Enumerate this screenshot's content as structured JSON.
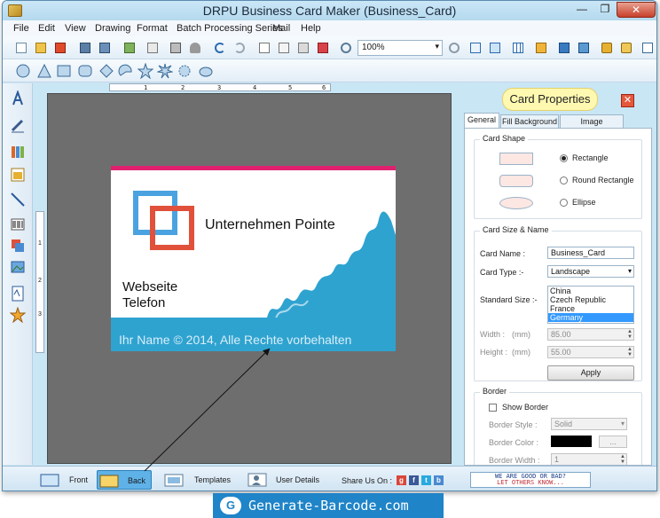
{
  "window": {
    "title": "DRPU Business Card Maker (Business_Card)",
    "minimize": "—",
    "maximize": "❐",
    "close": "✕"
  },
  "menu": [
    "File",
    "Edit",
    "View",
    "Drawing",
    "Format",
    "Batch Processing Series",
    "Mail",
    "Help"
  ],
  "toolbar": {
    "zoom_value": "100%",
    "zoom_arrow": "▾"
  },
  "ruler": {
    "h_marks": [
      "1",
      "2",
      "3",
      "4",
      "5",
      "6"
    ],
    "v_marks": [
      "1",
      "2",
      "3"
    ]
  },
  "card": {
    "company": "Unternehmen Pointe",
    "website": "Webseite",
    "phone": "Telefon",
    "footer": "Ihr Name © 2014, Alle Rechte vorbehalten"
  },
  "properties": {
    "title": "Card Properties",
    "close": "✕",
    "tabs": [
      "General",
      "Fill Background",
      "Image Processing"
    ],
    "card_shape": {
      "title": "Card Shape",
      "options": [
        "Rectangle",
        "Round Rectangle",
        "Ellipse"
      ],
      "selected": "Rectangle"
    },
    "size": {
      "title": "Card Size & Name",
      "name_label": "Card Name :",
      "name_value": "Business_Card",
      "type_label": "Card Type :-",
      "type_value": "Landscape",
      "standard_label": "Standard Size :-",
      "standard_options": [
        "China",
        "Czech Republic",
        "France",
        "Germany"
      ],
      "standard_selected": "Germany",
      "width_label": "Width :",
      "height_label": "Height :",
      "unit": "(mm)",
      "width_value": "85.00",
      "height_value": "55.00",
      "apply": "Apply"
    },
    "border": {
      "title": "Border",
      "show_label": "Show Border",
      "style_label": "Border Style :",
      "style_value": "Solid",
      "color_label": "Border Color :",
      "color_value": "#000000",
      "color_more": "...",
      "width_label": "Border Width :",
      "width_value": "1"
    }
  },
  "bottom": {
    "front": "Front",
    "back": "Back",
    "templates": "Templates",
    "user_details": "User Details",
    "share_label": "Share Us On :",
    "feedback_line1": "WE ARE GOOD OR BAD?",
    "feedback_line2": "LET OTHERS KNOW..."
  },
  "banner": {
    "text": "Generate-Barcode.com",
    "logo": "G"
  },
  "colors": {
    "card_accent": "#e0216f",
    "card_blue": "#2fa3d0",
    "logo_blue": "#4aa3e0",
    "logo_red": "#e0503a",
    "banner": "#1f84c8"
  }
}
